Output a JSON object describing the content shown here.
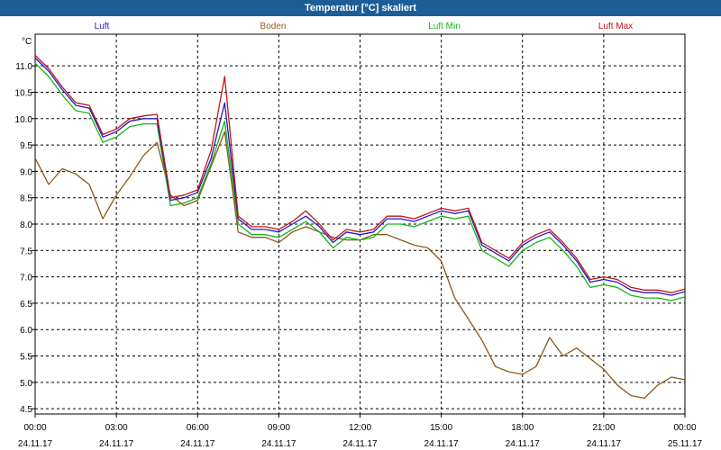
{
  "window": {
    "title": "Temperatur [°C] skaliert"
  },
  "colors": {
    "luft": "#1c1cc8",
    "boden": "#8b5a1a",
    "luft_min": "#19b219",
    "luft_max": "#c81414",
    "titlebar": "#1b5e97",
    "grid": "#000000"
  },
  "chart_data": {
    "type": "line",
    "title": "Temperatur [°C] skaliert",
    "ylabel": "°C",
    "xlabel": "",
    "ylim": [
      4.4,
      11.6
    ],
    "xlim": [
      0,
      24
    ],
    "grid": true,
    "legend_position": "top",
    "y_ticks": [
      "11.0",
      "10.5",
      "10.0",
      "9.5",
      "9.0",
      "8.5",
      "8.0",
      "7.5",
      "7.0",
      "6.5",
      "6.0",
      "5.5",
      "5.0",
      "4.5"
    ],
    "x_ticks": [
      {
        "time": "00:00",
        "date": "24.11.17"
      },
      {
        "time": "03:00",
        "date": "24.11.17"
      },
      {
        "time": "06:00",
        "date": "24.11.17"
      },
      {
        "time": "09:00",
        "date": "24.11.17"
      },
      {
        "time": "12:00",
        "date": "24.11.17"
      },
      {
        "time": "15:00",
        "date": "24.11.17"
      },
      {
        "time": "18:00",
        "date": "24.11.17"
      },
      {
        "time": "21:00",
        "date": "24.11.17"
      },
      {
        "time": "00:00",
        "date": "25.11.17"
      }
    ],
    "x": [
      0,
      0.5,
      1,
      1.5,
      2,
      2.5,
      3,
      3.5,
      4,
      4.5,
      5,
      5.5,
      6,
      6.5,
      7,
      7.5,
      8,
      8.5,
      9,
      9.5,
      10,
      10.5,
      11,
      11.5,
      12,
      12.5,
      13,
      13.5,
      14,
      14.5,
      15,
      15.5,
      16,
      16.5,
      17,
      17.5,
      18,
      18.5,
      19,
      19.5,
      20,
      20.5,
      21,
      21.5,
      22,
      22.5,
      23,
      23.5,
      24
    ],
    "series": [
      {
        "name": "Luft",
        "values": [
          11.15,
          10.9,
          10.55,
          10.25,
          10.2,
          9.65,
          9.75,
          9.95,
          10.0,
          10.0,
          8.45,
          8.5,
          8.6,
          9.25,
          10.3,
          8.1,
          7.9,
          7.9,
          7.85,
          8.0,
          8.15,
          7.95,
          7.65,
          7.85,
          7.8,
          7.85,
          8.1,
          8.1,
          8.05,
          8.15,
          8.25,
          8.2,
          8.25,
          7.6,
          7.45,
          7.3,
          7.6,
          7.75,
          7.85,
          7.6,
          7.3,
          6.9,
          6.95,
          6.9,
          6.75,
          6.7,
          6.7,
          6.65,
          6.72
        ]
      },
      {
        "name": "Boden",
        "values": [
          9.25,
          8.75,
          9.05,
          8.95,
          8.75,
          8.1,
          8.55,
          8.9,
          9.3,
          9.55,
          8.55,
          8.35,
          8.45,
          9.1,
          9.75,
          7.85,
          7.75,
          7.75,
          7.65,
          7.85,
          7.95,
          7.85,
          7.75,
          7.7,
          7.7,
          7.8,
          7.8,
          7.7,
          7.6,
          7.55,
          7.3,
          6.6,
          6.2,
          5.8,
          5.3,
          5.2,
          5.15,
          5.3,
          5.85,
          5.5,
          5.65,
          5.45,
          5.25,
          4.95,
          4.75,
          4.7,
          4.95,
          5.1,
          5.05
        ]
      },
      {
        "name": "Luft Min",
        "values": [
          11.05,
          10.8,
          10.45,
          10.15,
          10.1,
          9.55,
          9.65,
          9.85,
          9.9,
          9.9,
          8.35,
          8.4,
          8.5,
          9.15,
          9.95,
          8.0,
          7.8,
          7.8,
          7.75,
          7.9,
          8.05,
          7.85,
          7.55,
          7.75,
          7.7,
          7.75,
          8.0,
          8.0,
          7.95,
          8.05,
          8.15,
          8.1,
          8.15,
          7.5,
          7.35,
          7.2,
          7.5,
          7.65,
          7.75,
          7.5,
          7.2,
          6.8,
          6.85,
          6.8,
          6.65,
          6.6,
          6.6,
          6.55,
          6.62
        ]
      },
      {
        "name": "Luft Max",
        "values": [
          11.2,
          10.95,
          10.6,
          10.3,
          10.25,
          9.7,
          9.8,
          10.0,
          10.05,
          10.08,
          8.5,
          8.55,
          8.65,
          9.4,
          10.8,
          8.15,
          7.95,
          7.95,
          7.9,
          8.05,
          8.25,
          8.0,
          7.7,
          7.9,
          7.85,
          7.9,
          8.15,
          8.15,
          8.1,
          8.2,
          8.3,
          8.25,
          8.3,
          7.65,
          7.5,
          7.35,
          7.65,
          7.8,
          7.9,
          7.65,
          7.35,
          6.95,
          7.0,
          6.95,
          6.8,
          6.75,
          6.75,
          6.7,
          6.77
        ]
      }
    ]
  }
}
